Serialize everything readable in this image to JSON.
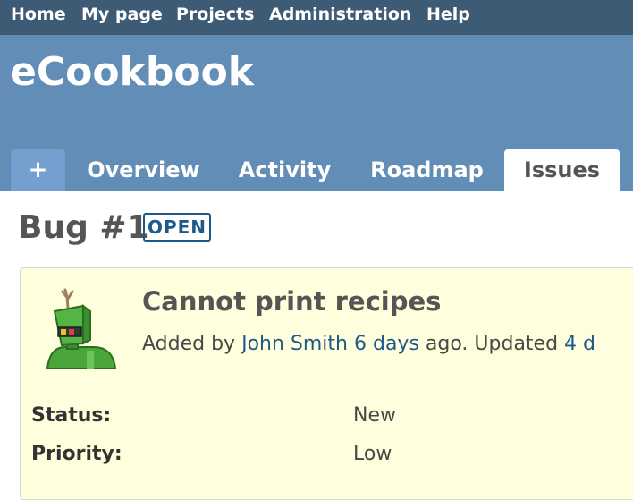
{
  "top_menu": {
    "items": [
      "Home",
      "My page",
      "Projects",
      "Administration",
      "Help"
    ]
  },
  "header": {
    "project_title": "eCookbook"
  },
  "tabs": {
    "new_label": "+",
    "items": [
      "Overview",
      "Activity",
      "Roadmap",
      "Issues"
    ],
    "selected": "Issues"
  },
  "issue": {
    "heading": "Bug #1",
    "status_badge": "OPEN",
    "subject": "Cannot print recipes",
    "added_by_prefix": "Added by ",
    "author": "John Smith",
    "created": "6 days",
    "ago_updated": " ago. Updated ",
    "updated": "4 d",
    "attributes": [
      {
        "label": "Status:",
        "value": "New"
      },
      {
        "label": "Priority:",
        "value": "Low"
      }
    ]
  },
  "colors": {
    "top_menu_bg": "#3e5b76",
    "header_bg": "#628db6",
    "link": "#1d5a8c",
    "issue_box_bg": "#ffffdd"
  },
  "icons": {
    "avatar": "robot-avatar-icon"
  }
}
